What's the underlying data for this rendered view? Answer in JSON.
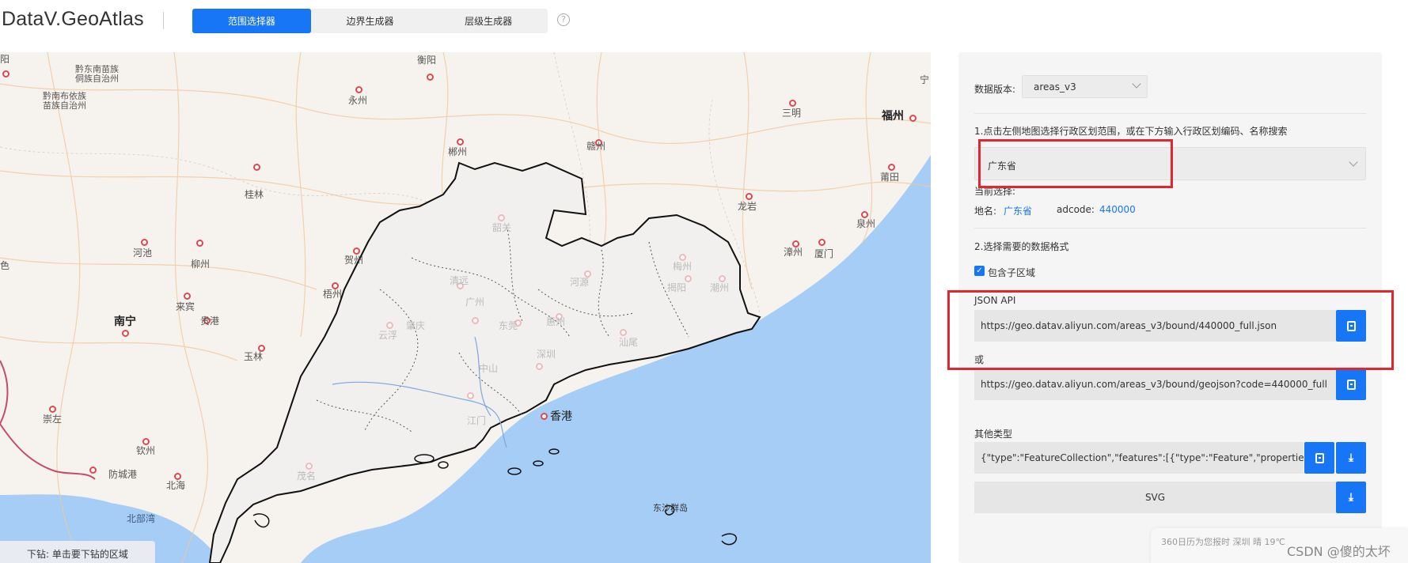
{
  "header": {
    "logo": "DataV.GeoAtlas",
    "tabs": [
      {
        "label": "范围选择器",
        "active": true
      },
      {
        "label": "边界生成器",
        "active": false
      },
      {
        "label": "层级生成器",
        "active": false
      }
    ],
    "help_icon": "question-circle-icon"
  },
  "map": {
    "labels": {
      "yang": "阳",
      "qiandongnan": "黔东南苗族\n侗族自治州",
      "qiannan": "黔南布依族\n苗族自治州",
      "hengyang": "衡阳",
      "yongzhou": "永州",
      "chenzhou": "郴州",
      "ganzhou": "赣州",
      "sanming": "三明",
      "fuzhou": "福州",
      "ning": "宁",
      "putian": "莆田",
      "guilin": "桂林",
      "shaoguan": "韶关",
      "longyan": "龙岩",
      "quanzhou": "泉州",
      "hechi": "河池",
      "liuzhou": "柳州",
      "hezhou": "贺州",
      "meizhou": "梅州",
      "zhangzhou": "漳州",
      "xiamen": "厦门",
      "se": "色",
      "laibin": "来宾",
      "wuzhou": "梧州",
      "qingyuan": "清远",
      "heyuan": "河源",
      "jieyang": "揭阳",
      "chaozhou": "潮州",
      "nanning": "南宁",
      "guigang": "贵港",
      "guangzhou": "广州",
      "zhaoqing": "肇庆",
      "dongguan": "东莞",
      "huizhou": "惠州",
      "yunfu": "云浮",
      "shantou": "汕尾",
      "yulin": "玉林",
      "shenzhen": "深圳",
      "zhongshan": "中山",
      "xianggang": "香港",
      "chongzuo": "崇左",
      "jiangmen": "江门",
      "qinzhou": "钦州",
      "fangchenggang": "防城港",
      "beihai": "北海",
      "maoming": "茂名",
      "beibuwan": "北部湾",
      "dongsha": "东沙群岛"
    },
    "drill_hint": "下钻:   单击要下钻的区域"
  },
  "panel": {
    "data_version_label": "数据版本:",
    "data_version_value": "areas_v3",
    "step1_text": "1.点击左侧地图选择行政区划范围，或在下方输入行政区划编码、名称搜索",
    "region_select_value": "广东省",
    "current_selection_label": "当前选择:",
    "place_name_label": "地名:",
    "place_name_value": "广东省",
    "adcode_label": "adcode:",
    "adcode_value": "440000",
    "step2_text": "2.选择需要的数据格式",
    "include_sub_label": "包含子区域",
    "include_sub_checked": true,
    "json_api_label": "JSON API",
    "json_api_url": "https://geo.datav.aliyun.com/areas_v3/bound/440000_full.json",
    "or_label": "或",
    "geojson_url": "https://geo.datav.aliyun.com/areas_v3/bound/geojson?code=440000_full",
    "other_types_label": "其他类型",
    "feature_json": "{\"type\":\"FeatureCollection\",\"features\":[{\"type\":\"Feature\",\"properties\":{\"",
    "svg_label": "SVG"
  },
  "overlay": {
    "weather": "360日历为您报时  深圳  晴  19℃",
    "watermark": "CSDN @傻的太坏"
  }
}
